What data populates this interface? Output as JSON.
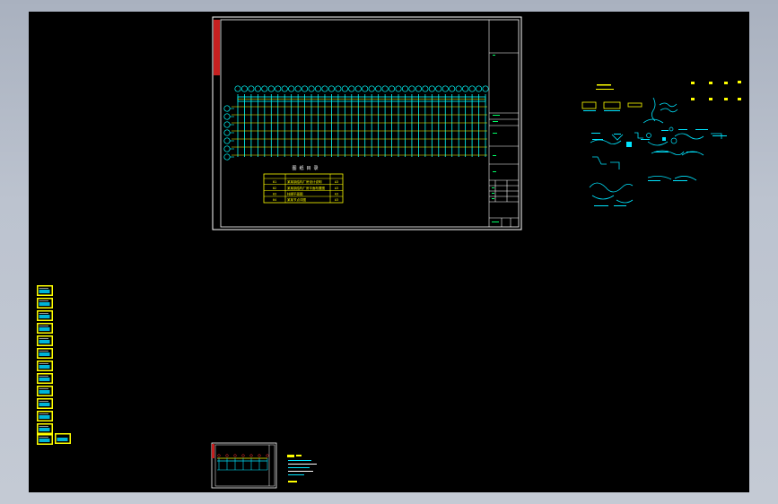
{
  "window": {
    "title": ""
  },
  "sheet": {
    "table_title": "图 纸 目 录",
    "table_rows": [
      {
        "no": "01",
        "name": "某某钢结构厂房设计说明",
        "scale": "A3"
      },
      {
        "no": "02",
        "name": "某某钢结构厂房平面布置图",
        "scale": "A3"
      },
      {
        "no": "03",
        "name": "柱脚平面图",
        "scale": "A3"
      },
      {
        "no": "04",
        "name": "某某节点详图",
        "scale": "A3"
      }
    ]
  },
  "colors": {
    "background": "#000000",
    "frame": "#ffffff",
    "axis": "#00ffff",
    "grid": "#ffff00",
    "accent": "#ff0000",
    "detail": "#00e5ff"
  },
  "icons": {
    "drawing_thumbnail": "sheet-thumbnail-icon",
    "axis_bubble": "axis-bubble-icon"
  }
}
